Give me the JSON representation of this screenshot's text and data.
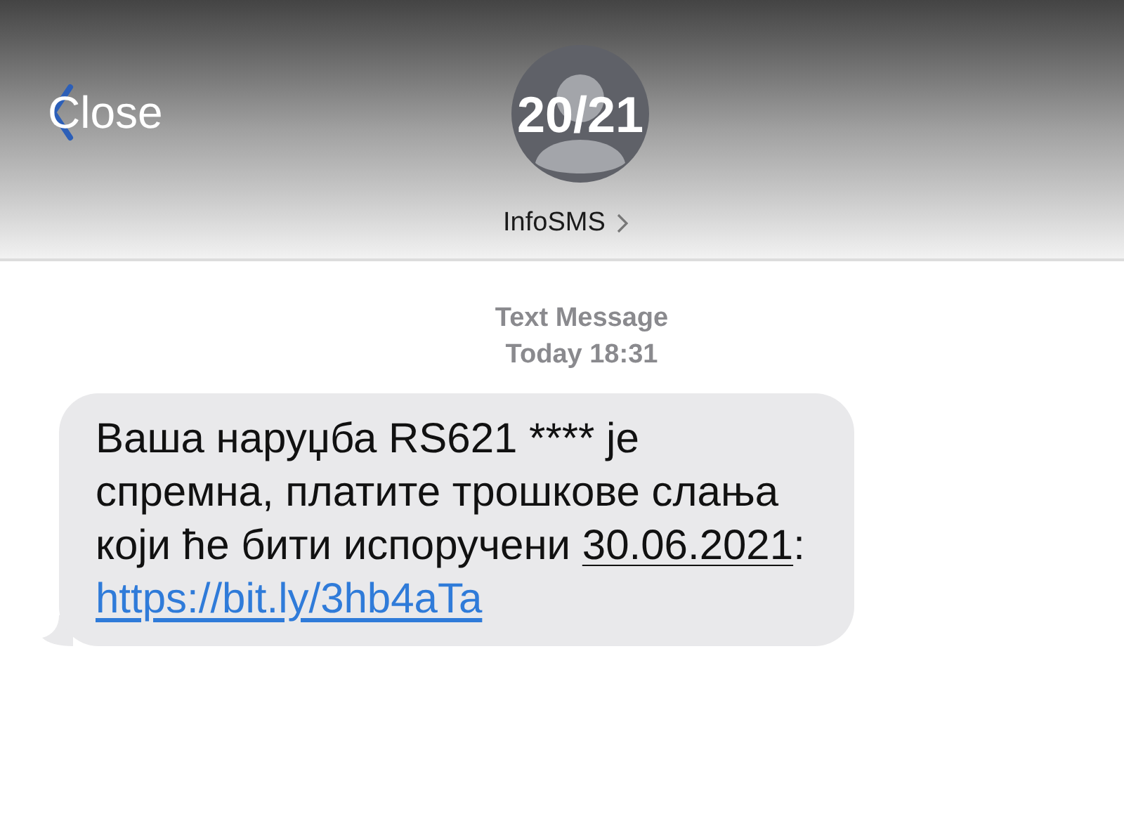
{
  "header": {
    "close": "Close",
    "counter": "20/21",
    "sender": "InfoSMS"
  },
  "timestamp": {
    "label": "Text Message",
    "time": "Today 18:31"
  },
  "message": {
    "text": "Ваша наруџба RS621 **** је спремна, платите трошкове слања који ће бити испоручени ",
    "date": "30.06.2021",
    "separator": ": ",
    "link": "https://bit.ly/3hb4aTa"
  }
}
